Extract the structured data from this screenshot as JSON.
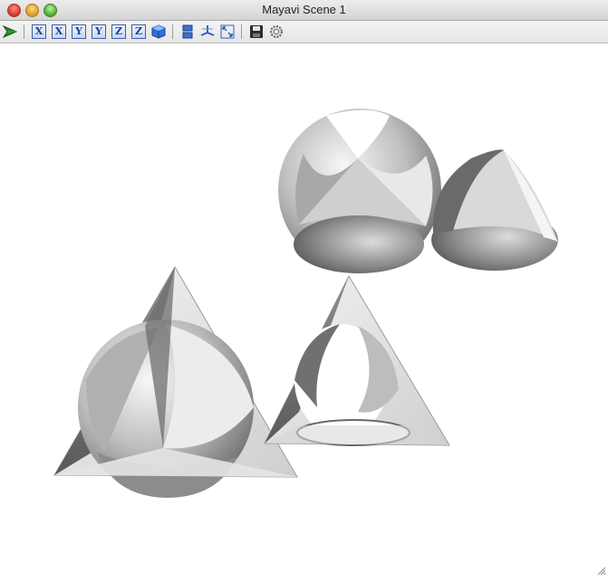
{
  "window": {
    "title": "Mayavi Scene 1"
  },
  "toolbar": {
    "buttons": [
      {
        "name": "mayavi-engine-icon"
      },
      {
        "label": "X"
      },
      {
        "label": "X"
      },
      {
        "label": "Y"
      },
      {
        "label": "Y"
      },
      {
        "label": "Z"
      },
      {
        "label": "Z"
      },
      {
        "name": "isometric-view-icon"
      },
      {
        "name": "toggle-parallel-projection-icon"
      },
      {
        "name": "toggle-axes-indicator-icon"
      },
      {
        "name": "full-screen-icon"
      },
      {
        "name": "save-icon"
      },
      {
        "name": "configure-icon"
      }
    ]
  },
  "scene": {
    "background": "#ffffff"
  }
}
